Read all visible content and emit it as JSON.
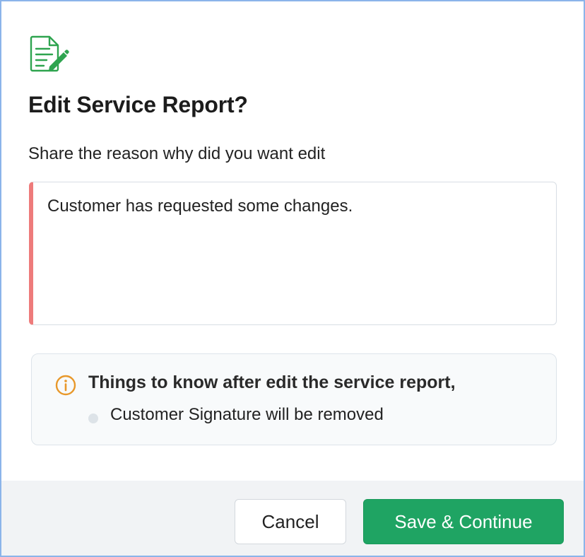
{
  "dialog": {
    "title": "Edit Service Report?",
    "prompt": "Share the reason why did you want edit",
    "reason_value": "Customer has requested some changes.",
    "icon": "edit-document-icon"
  },
  "notice": {
    "icon": "info-icon",
    "heading": "Things to know after edit the service report,",
    "items": [
      "Customer Signature will be removed"
    ]
  },
  "footer": {
    "cancel_label": "Cancel",
    "save_label": "Save & Continue"
  },
  "colors": {
    "accent": "#1fa463",
    "error_bar": "#ee7b7b",
    "info": "#e8982a",
    "icon_green": "#2ea44f"
  }
}
